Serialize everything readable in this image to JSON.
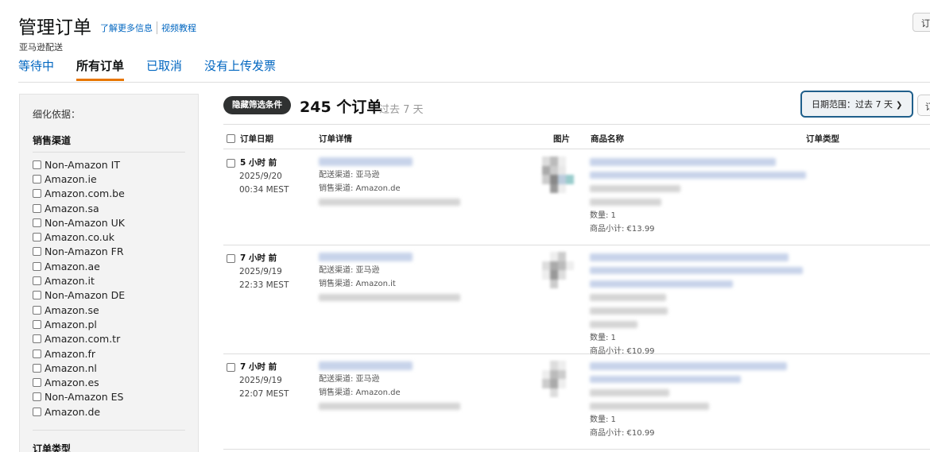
{
  "header": {
    "title": "管理订单",
    "link_more": "了解更多信息",
    "link_video": "视频教程",
    "subtitle": "亚马逊配送",
    "top_right_button": "订"
  },
  "tabs": [
    {
      "label": "等待中",
      "active": false
    },
    {
      "label": "所有订单",
      "active": true
    },
    {
      "label": "已取消",
      "active": false
    },
    {
      "label": "没有上传发票",
      "active": false
    }
  ],
  "sidebar": {
    "refine_label": "细化依据：",
    "channel_title": "销售渠道",
    "channels": [
      "Non-Amazon IT",
      "Amazon.ie",
      "Amazon.com.be",
      "Amazon.sa",
      "Non-Amazon UK",
      "Amazon.co.uk",
      "Non-Amazon FR",
      "Amazon.ae",
      "Amazon.it",
      "Non-Amazon DE",
      "Amazon.se",
      "Amazon.pl",
      "Amazon.com.tr",
      "Amazon.fr",
      "Amazon.nl",
      "Amazon.es",
      "Non-Amazon ES",
      "Amazon.de"
    ],
    "order_type_title": "订单类型"
  },
  "toolbar": {
    "hide_filters": "隐藏筛选条件",
    "order_count": "245 个订单",
    "period": "过去 7 天",
    "date_range_label": "日期范围：",
    "date_range_value": "过去 7 天",
    "right_button": "订"
  },
  "table": {
    "headers": {
      "date": "订单日期",
      "details": "订单详情",
      "image": "图片",
      "product_name": "商品名称",
      "order_type": "订单类型"
    },
    "rows": [
      {
        "ago": "5 小时 前",
        "date": "2025/9/20",
        "time": "00:34 MEST",
        "fulfillment": "配送渠道: 亚马逊",
        "channel": "销售渠道: Amazon.de",
        "quantity": "数量: 1",
        "subtotal": "商品小计: €13.99"
      },
      {
        "ago": "7 小时 前",
        "date": "2025/9/19",
        "time": "22:33 MEST",
        "fulfillment": "配送渠道: 亚马逊",
        "channel": "销售渠道: Amazon.it",
        "quantity": "数量: 1",
        "subtotal": "商品小计: €10.99"
      },
      {
        "ago": "7 小时 前",
        "date": "2025/9/19",
        "time": "22:07 MEST",
        "fulfillment": "配送渠道: 亚马逊",
        "channel": "销售渠道: Amazon.de",
        "quantity": "数量: 1",
        "subtotal": "商品小计: €10.99"
      }
    ]
  },
  "colors": {
    "link": "#0066c0",
    "active_tab_underline": "#e77600",
    "date_range_border": "#1f5f8b",
    "hide_button_bg": "#2f3131"
  }
}
